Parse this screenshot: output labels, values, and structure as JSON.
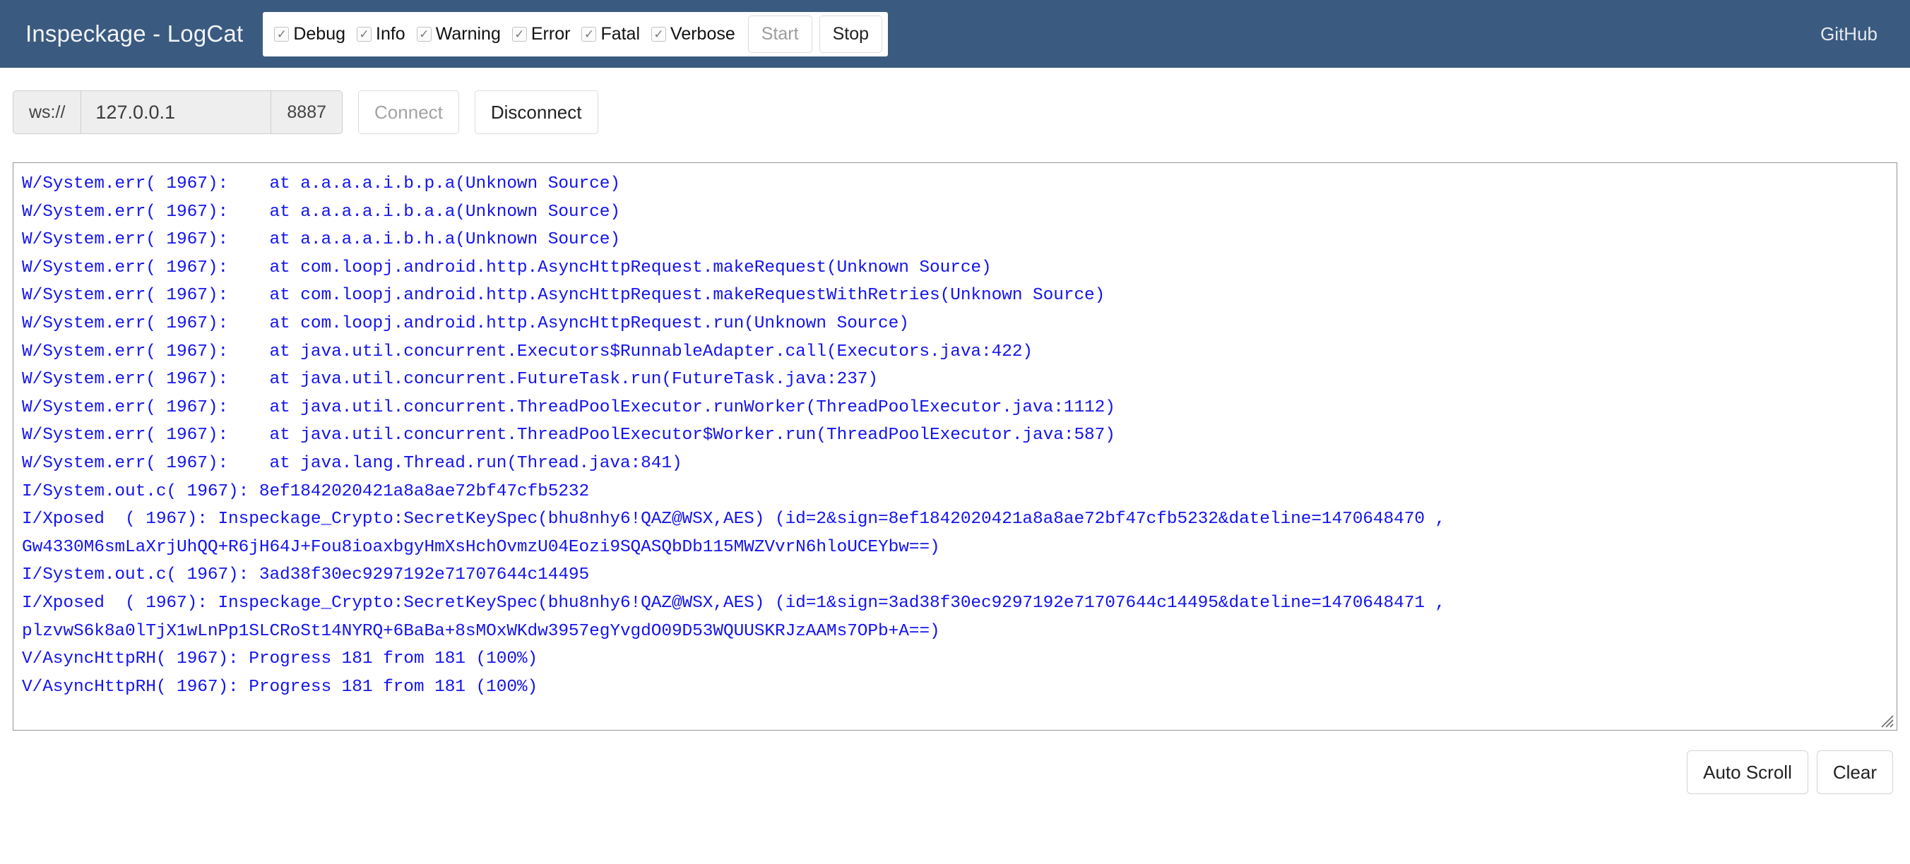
{
  "navbar": {
    "brand": "Inspeckage - LogCat",
    "filters": [
      {
        "label": "Debug",
        "checked": true,
        "mark": "✓"
      },
      {
        "label": "Info",
        "checked": true,
        "mark": "✓"
      },
      {
        "label": "Warning",
        "checked": true,
        "mark": "✓"
      },
      {
        "label": "Error",
        "checked": true,
        "mark": "✓"
      },
      {
        "label": "Fatal",
        "checked": true,
        "mark": "✓"
      },
      {
        "label": "Verbose",
        "checked": true,
        "mark": "✓"
      }
    ],
    "start_label": "Start",
    "stop_label": "Stop",
    "start_disabled": true,
    "stop_disabled": false,
    "github_label": "GitHub",
    "background_color": "#3a5a80",
    "brand_color": "#f2f4f6"
  },
  "connection": {
    "scheme_addon": "ws://",
    "host_value": "127.0.0.1",
    "host_placeholder": "127.0.0.1",
    "port_addon": "8887",
    "connect_label": "Connect",
    "disconnect_label": "Disconnect",
    "connect_disabled": true,
    "disconnect_disabled": false
  },
  "log": {
    "text_color": "#1414ee",
    "lines": [
      "W/System.err( 1967):    at a.a.a.a.i.b.p.a(Unknown Source)",
      "W/System.err( 1967):    at a.a.a.a.i.b.a.a(Unknown Source)",
      "W/System.err( 1967):    at a.a.a.a.i.b.h.a(Unknown Source)",
      "W/System.err( 1967):    at com.loopj.android.http.AsyncHttpRequest.makeRequest(Unknown Source)",
      "W/System.err( 1967):    at com.loopj.android.http.AsyncHttpRequest.makeRequestWithRetries(Unknown Source)",
      "W/System.err( 1967):    at com.loopj.android.http.AsyncHttpRequest.run(Unknown Source)",
      "W/System.err( 1967):    at java.util.concurrent.Executors$RunnableAdapter.call(Executors.java:422)",
      "W/System.err( 1967):    at java.util.concurrent.FutureTask.run(FutureTask.java:237)",
      "W/System.err( 1967):    at java.util.concurrent.ThreadPoolExecutor.runWorker(ThreadPoolExecutor.java:1112)",
      "W/System.err( 1967):    at java.util.concurrent.ThreadPoolExecutor$Worker.run(ThreadPoolExecutor.java:587)",
      "W/System.err( 1967):    at java.lang.Thread.run(Thread.java:841)",
      "I/System.out.c( 1967): 8ef1842020421a8a8ae72bf47cfb5232",
      "I/Xposed  ( 1967): Inspeckage_Crypto:SecretKeySpec(bhu8nhy6!QAZ@WSX,AES) (id=2&sign=8ef1842020421a8a8ae72bf47cfb5232&dateline=1470648470 ,",
      "Gw4330M6smLaXrjUhQQ+R6jH64J+Fou8ioaxbgyHmXsHchOvmzU04Eozi9SQASQbDb115MWZVvrN6hloUCEYbw==)",
      "I/System.out.c( 1967): 3ad38f30ec9297192e71707644c14495",
      "I/Xposed  ( 1967): Inspeckage_Crypto:SecretKeySpec(bhu8nhy6!QAZ@WSX,AES) (id=1&sign=3ad38f30ec9297192e71707644c14495&dateline=1470648471 ,",
      "plzvwS6k8a0lTjX1wLnPp1SLCRoSt14NYRQ+6BaBa+8sMOxWKdw3957egYvgdO09D53WQUUSKRJzAAMs7OPb+A==)",
      "V/AsyncHttpRH( 1967): Progress 181 from 181 (100%)",
      "V/AsyncHttpRH( 1967): Progress 181 from 181 (100%)"
    ]
  },
  "footer": {
    "auto_scroll_label": "Auto Scroll",
    "clear_label": "Clear"
  }
}
